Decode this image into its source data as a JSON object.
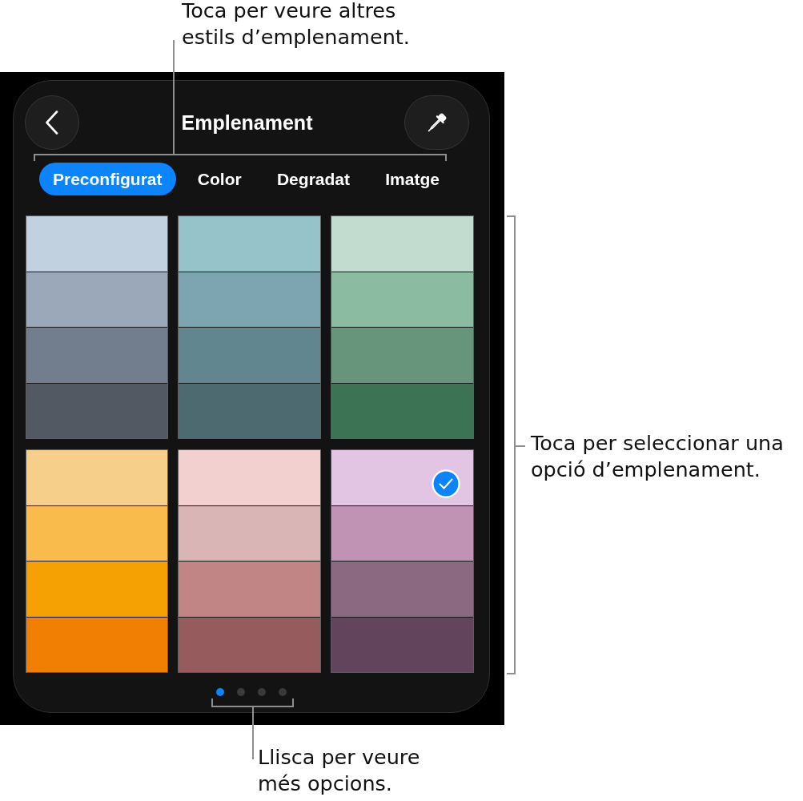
{
  "title": "Emplenament",
  "tabs": [
    {
      "label": "Preconfigurat",
      "selected": true
    },
    {
      "label": "Color",
      "selected": false
    },
    {
      "label": "Degradat",
      "selected": false
    },
    {
      "label": "Imatge",
      "selected": false
    }
  ],
  "presets": [
    {
      "selected": false,
      "stripes": [
        {
          "color": "#c2d1e0"
        },
        {
          "color": "#9ba8b9"
        },
        {
          "color": "#727e8e"
        },
        {
          "color": "#535962"
        }
      ]
    },
    {
      "selected": false,
      "stripes": [
        {
          "color": "#95c3c9"
        },
        {
          "color": "#7ca4b1"
        },
        {
          "color": "#628690"
        },
        {
          "color": "#4d6a70"
        }
      ]
    },
    {
      "selected": false,
      "stripes": [
        {
          "color": "#c2dccf"
        },
        {
          "color": "#8bbba0"
        },
        {
          "color": "#66957b"
        },
        {
          "color": "#3c7355"
        }
      ]
    },
    {
      "selected": false,
      "stripes": [
        {
          "color": "#f6d08a"
        },
        {
          "color": "#f8bb4c"
        },
        {
          "color": "#f5a003"
        },
        {
          "color": "#f07f04"
        }
      ]
    },
    {
      "selected": false,
      "stripes": [
        {
          "color": "#f2d0d0"
        },
        {
          "color": "#dab5b5"
        },
        {
          "color": "#c28585"
        },
        {
          "color": "#955b5d"
        }
      ]
    },
    {
      "selected": true,
      "stripes": [
        {
          "color": "#e1c5e2"
        },
        {
          "color": "#c092b4"
        },
        {
          "color": "#8b6a81"
        },
        {
          "color": "#62445d"
        }
      ]
    }
  ],
  "page_dots": [
    {
      "selected": true
    },
    {
      "selected": false
    },
    {
      "selected": false
    },
    {
      "selected": false
    }
  ],
  "callouts": [
    {
      "kind": "top",
      "text": "Toca per veure altres estils d’emplenament."
    },
    {
      "kind": "right",
      "text": "Toca per seleccionar una opció d’emplenament."
    },
    {
      "kind": "bottom",
      "text": "Llisca per veure més opcions."
    }
  ]
}
